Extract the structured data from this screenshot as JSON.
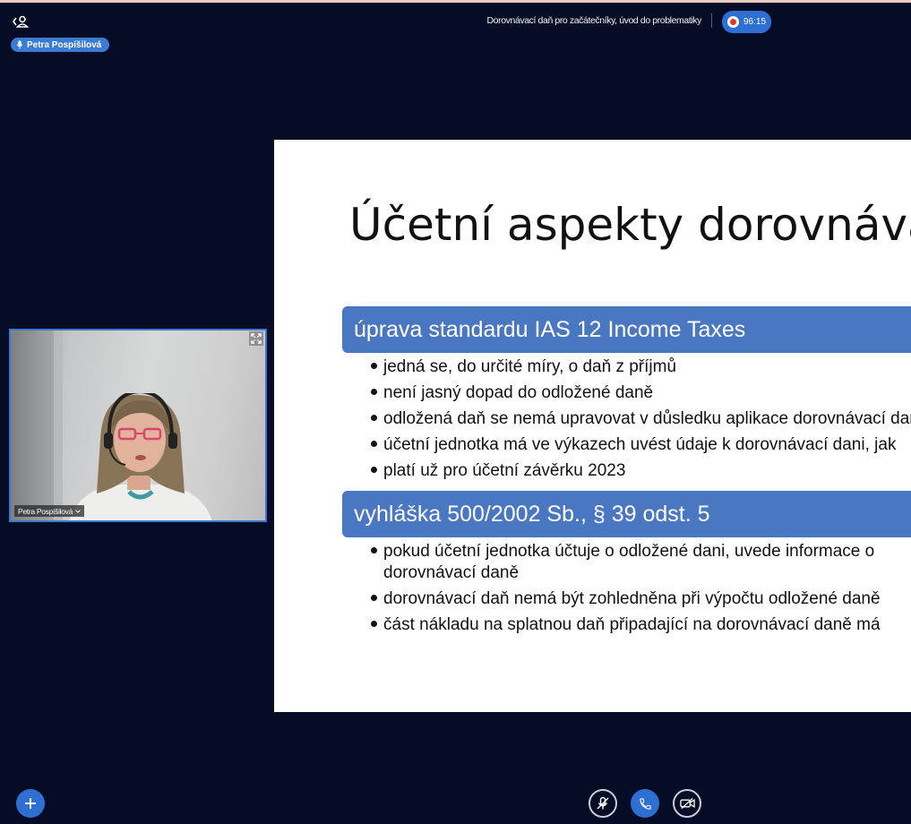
{
  "header": {
    "meeting_title": "Dorovnávací daň pro začátečníky, úvod do problematiky",
    "recording_time": "96:15",
    "participants_icon": "participants-panel-icon",
    "record_icon": "record-icon"
  },
  "speaker_badge": {
    "name": "Petra Pospíšilová",
    "icon": "microphone-icon"
  },
  "slide": {
    "title": "Účetní aspekty dorovnávací daně",
    "sections": [
      {
        "heading": "úprava standardu IAS 12 Income Taxes",
        "bullets": [
          "jedná se, do určité míry, o daň z příjmů",
          "není jasný dopad do odložené daně",
          "odložená daň se nemá upravovat v důsledku aplikace dorovnávací daně",
          "účetní jednotka má ve výkazech uvést údaje k dorovnávací dani, jak",
          "platí už pro účetní závěrku 2023"
        ]
      },
      {
        "heading": "vyhláška 500/2002 Sb., § 39 odst. 5",
        "bullets": [
          "pokud účetní jednotka účtuje o odložené dani, uvede informace o",
          "dorovnávací daně",
          "dorovnávací daň nemá být zohledněna při výpočtu odložené daně",
          "část nákladu na splatnou daň připadající na dorovnávací daně má"
        ]
      }
    ]
  },
  "video_tile": {
    "name": "Petra Pospíšilová",
    "expand_icon": "expand-icon",
    "chevron_icon": "chevron-down-icon"
  },
  "controls": {
    "add_icon": "plus-icon",
    "mute_icon": "microphone-muted-icon",
    "hangup_icon": "phone-icon",
    "camera_icon": "camera-off-icon"
  },
  "colors": {
    "background": "#050c25",
    "accent": "#2e6fd3",
    "slide_section_bar": "#4a77c2",
    "recording_dot": "#e0362f"
  }
}
